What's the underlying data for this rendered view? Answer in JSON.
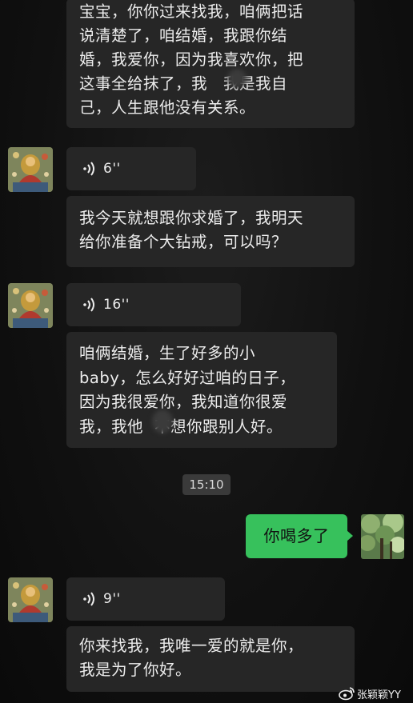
{
  "messages": {
    "msg1": {
      "lines": [
        "宝宝，你你过来找我，咱俩把话",
        "说清楚了，咱结婚，我跟你结",
        "婚，我爱你，因为我喜欢你，把",
        "这事全给抹了，我",
        "我是我自",
        "己，人生跟他没有关系。"
      ]
    },
    "voice1": {
      "duration": "6''"
    },
    "msg2": {
      "lines": [
        "我今天就想跟你求婚了，我明天",
        "给你准备个大钻戒，可以吗？"
      ]
    },
    "voice2": {
      "duration": "16''"
    },
    "msg3": {
      "lines": [
        "咱俩结婚，生了好多的小",
        "baby，怎么好好过咱的日子，",
        "因为我很爱你，我知道你很爱",
        "我，我他",
        "不想你跟别人好。"
      ]
    },
    "time_divider": "15:10",
    "sent_msg": "你喝多了",
    "voice3": {
      "duration": "9''"
    },
    "msg4": {
      "lines": [
        "你来找我，我唯一爱的就是你，",
        "我是为了你好。"
      ]
    }
  },
  "watermark": {
    "text": "张颖颖YY",
    "icon": "weibo-icon"
  },
  "icons": {
    "voice": "voice-wave-icon",
    "avatar_other": "thangka-avatar",
    "avatar_self": "tree-photo-avatar"
  }
}
